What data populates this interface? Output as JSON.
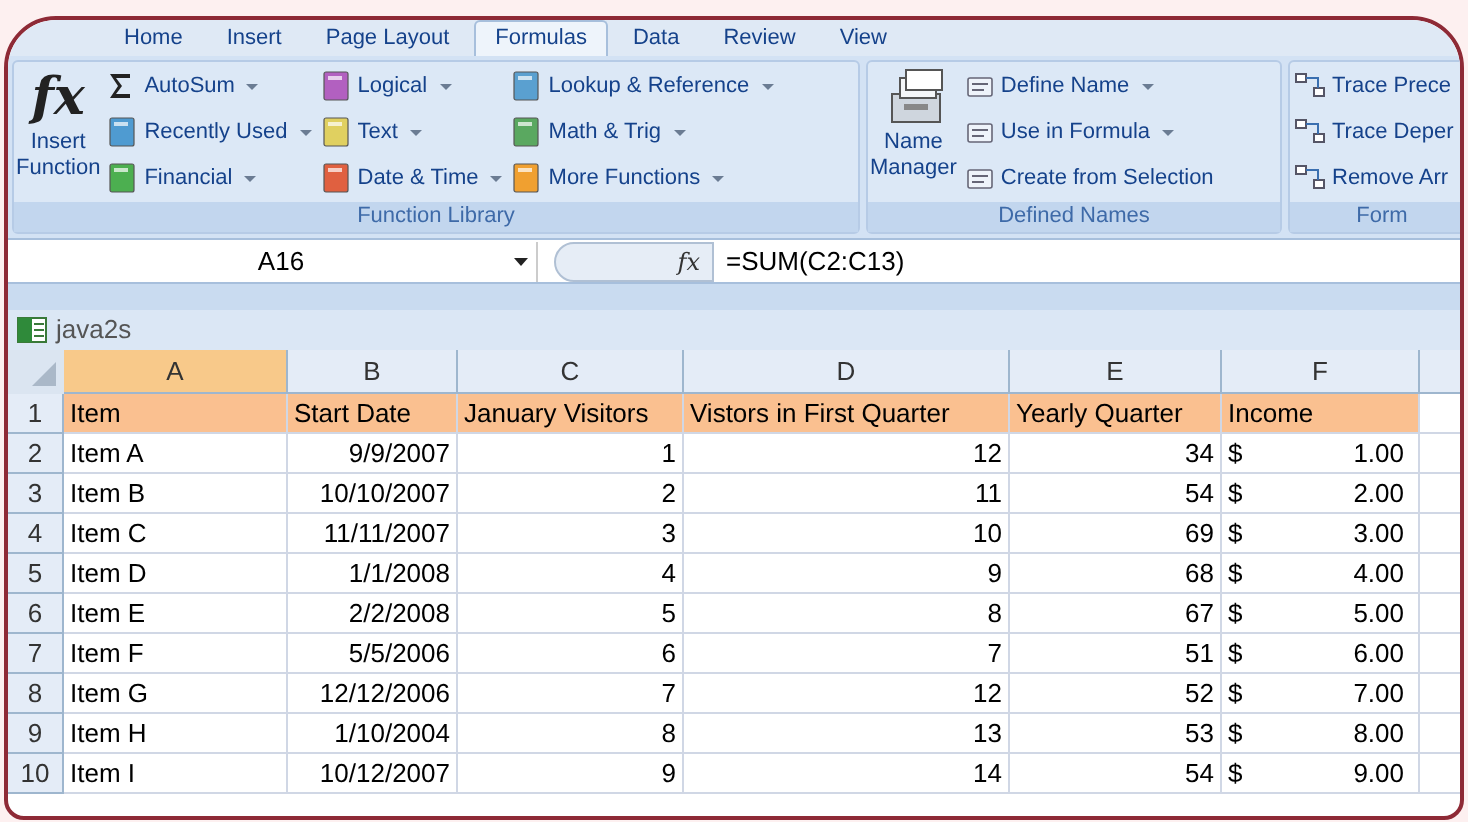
{
  "tabs": [
    {
      "label": "Home",
      "selected": false
    },
    {
      "label": "Insert",
      "selected": false
    },
    {
      "label": "Page Layout",
      "selected": false
    },
    {
      "label": "Formulas",
      "selected": true
    },
    {
      "label": "Data",
      "selected": false
    },
    {
      "label": "Review",
      "selected": false
    },
    {
      "label": "View",
      "selected": false
    }
  ],
  "ribbon_groups": [
    {
      "label": "Function Library",
      "large": {
        "icon_text": "fx",
        "lines": [
          "Insert",
          "Function"
        ]
      },
      "buttons": [
        {
          "label": "AutoSum",
          "dropdown": true
        },
        {
          "label": "Recently Used",
          "dropdown": true
        },
        {
          "label": "Financial",
          "dropdown": true
        },
        {
          "label": "Logical",
          "dropdown": true
        },
        {
          "label": "Text",
          "dropdown": true
        },
        {
          "label": "Date & Time",
          "dropdown": true
        },
        {
          "label": "Lookup & Reference",
          "dropdown": true
        },
        {
          "label": "Math & Trig",
          "dropdown": true
        },
        {
          "label": "More Functions",
          "dropdown": true
        }
      ]
    },
    {
      "label": "Defined Names",
      "large": {
        "lines": [
          "Name",
          "Manager"
        ]
      },
      "buttons": [
        {
          "label": "Define Name",
          "dropdown": true
        },
        {
          "label": "Use in Formula",
          "dropdown": true
        },
        {
          "label": "Create from Selection",
          "dropdown": false
        }
      ]
    },
    {
      "label": "Form",
      "buttons": [
        {
          "label": "Trace Prece",
          "dropdown": false
        },
        {
          "label": "Trace Deper",
          "dropdown": false
        },
        {
          "label": "Remove Arr",
          "dropdown": false
        }
      ]
    }
  ],
  "formula_bar": {
    "name_box": "A16",
    "function_label": "fx",
    "formula": "=SUM(C2:C13)"
  },
  "workbook": {
    "title": "java2s"
  },
  "sheet": {
    "columns": [
      {
        "label": "A",
        "selected": true
      },
      {
        "label": "B",
        "selected": false
      },
      {
        "label": "C",
        "selected": false
      },
      {
        "label": "D",
        "selected": false
      },
      {
        "label": "E",
        "selected": false
      },
      {
        "label": "F",
        "selected": false
      }
    ],
    "rows": [
      {
        "number": "1",
        "highlighted": true,
        "cells": [
          "Item",
          "Start Date",
          "January Visitors",
          "Vistors in First Quarter",
          "Yearly Quarter",
          "Income"
        ]
      },
      {
        "number": "2",
        "highlighted": false,
        "cells": [
          "Item A",
          "9/9/2007",
          "1",
          "12",
          "34",
          {
            "symbol": "$",
            "amount": "1.00"
          }
        ]
      },
      {
        "number": "3",
        "highlighted": false,
        "cells": [
          "Item B",
          "10/10/2007",
          "2",
          "11",
          "54",
          {
            "symbol": "$",
            "amount": "2.00"
          }
        ]
      },
      {
        "number": "4",
        "highlighted": false,
        "cells": [
          "Item C",
          "11/11/2007",
          "3",
          "10",
          "69",
          {
            "symbol": "$",
            "amount": "3.00"
          }
        ]
      },
      {
        "number": "5",
        "highlighted": false,
        "cells": [
          "Item D",
          "1/1/2008",
          "4",
          "9",
          "68",
          {
            "symbol": "$",
            "amount": "4.00"
          }
        ]
      },
      {
        "number": "6",
        "highlighted": false,
        "cells": [
          "Item E",
          "2/2/2008",
          "5",
          "8",
          "67",
          {
            "symbol": "$",
            "amount": "5.00"
          }
        ]
      },
      {
        "number": "7",
        "highlighted": false,
        "cells": [
          "Item F",
          "5/5/2006",
          "6",
          "7",
          "51",
          {
            "symbol": "$",
            "amount": "6.00"
          }
        ]
      },
      {
        "number": "8",
        "highlighted": false,
        "cells": [
          "Item G",
          "12/12/2006",
          "7",
          "12",
          "52",
          {
            "symbol": "$",
            "amount": "7.00"
          }
        ]
      },
      {
        "number": "9",
        "highlighted": false,
        "cells": [
          "Item H",
          "1/10/2004",
          "8",
          "13",
          "53",
          {
            "symbol": "$",
            "amount": "8.00"
          }
        ]
      },
      {
        "number": "10",
        "highlighted": false,
        "cells": [
          "Item I",
          "10/12/2007",
          "9",
          "14",
          "54",
          {
            "symbol": "$",
            "amount": "9.00"
          }
        ]
      }
    ]
  }
}
